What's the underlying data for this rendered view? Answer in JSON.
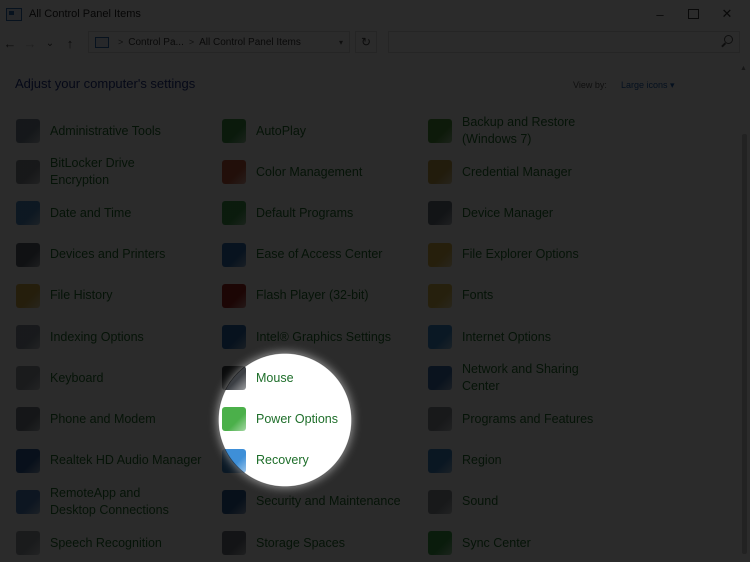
{
  "window": {
    "title": "All Control Panel Items",
    "minimize": "–",
    "close": "✕"
  },
  "nav": {
    "back": "←",
    "forward": "→",
    "recent": "⌄",
    "up": "↑",
    "refresh": "↻",
    "breadcrumb": [
      "Control Pa...",
      "All Control Panel Items"
    ],
    "breadcrumb_sep": ">",
    "search_placeholder": ""
  },
  "header": {
    "title": "Adjust your computer's settings",
    "view_by_label": "View by:",
    "view_by_value": "Large icons"
  },
  "items": [
    {
      "label": "Administrative Tools",
      "icon": "administrative-tools-icon",
      "color": "#7c8a99"
    },
    {
      "label": "AutoPlay",
      "icon": "autoplay-icon",
      "color": "#3f9b4a"
    },
    {
      "label": "Backup and Restore (Windows 7)",
      "icon": "backup-restore-icon",
      "color": "#4e9a3a"
    },
    {
      "label": "BitLocker Drive Encryption",
      "icon": "bitlocker-icon",
      "color": "#8a8f96"
    },
    {
      "label": "Color Management",
      "icon": "color-management-icon",
      "color": "#c85a3c"
    },
    {
      "label": "Credential Manager",
      "icon": "credential-manager-icon",
      "color": "#c9a54a"
    },
    {
      "label": "Date and Time",
      "icon": "date-time-icon",
      "color": "#4f8fc9"
    },
    {
      "label": "Default Programs",
      "icon": "default-programs-icon",
      "color": "#3fa24c"
    },
    {
      "label": "Device Manager",
      "icon": "device-manager-icon",
      "color": "#6d7785"
    },
    {
      "label": "Devices and Printers",
      "icon": "devices-printers-icon",
      "color": "#5c6470"
    },
    {
      "label": "Ease of Access Center",
      "icon": "ease-of-access-icon",
      "color": "#2f6fb5"
    },
    {
      "label": "File Explorer Options",
      "icon": "file-explorer-options-icon",
      "color": "#e0b84a"
    },
    {
      "label": "File History",
      "icon": "file-history-icon",
      "color": "#d9b24a"
    },
    {
      "label": "Flash Player (32-bit)",
      "icon": "flash-player-icon",
      "color": "#a8221c"
    },
    {
      "label": "Fonts",
      "icon": "fonts-icon",
      "color": "#e3c04e"
    },
    {
      "label": "Indexing Options",
      "icon": "indexing-options-icon",
      "color": "#8c96a3"
    },
    {
      "label": "Intel® Graphics Settings",
      "icon": "intel-graphics-icon",
      "color": "#2b6cb0"
    },
    {
      "label": "Internet Options",
      "icon": "internet-options-icon",
      "color": "#3b8fd4"
    },
    {
      "label": "Keyboard",
      "icon": "keyboard-icon",
      "color": "#9aa0a8"
    },
    {
      "label": "Mouse",
      "icon": "mouse-icon",
      "color": "#3c3f44"
    },
    {
      "label": "Network and Sharing Center",
      "icon": "network-sharing-icon",
      "color": "#3a6fb0"
    },
    {
      "label": "Phone and Modem",
      "icon": "phone-modem-icon",
      "color": "#7a828c"
    },
    {
      "label": "Power Options",
      "icon": "power-options-icon",
      "color": "#4bb04a"
    },
    {
      "label": "Programs and Features",
      "icon": "programs-features-icon",
      "color": "#8d939b"
    },
    {
      "label": "Realtek HD Audio Manager",
      "icon": "realtek-audio-icon",
      "color": "#2f5f9e"
    },
    {
      "label": "Recovery",
      "icon": "recovery-icon",
      "color": "#3e8fd8"
    },
    {
      "label": "Region",
      "icon": "region-icon",
      "color": "#3c86c9"
    },
    {
      "label": "RemoteApp and Desktop Connections",
      "icon": "remoteapp-icon",
      "color": "#4e82c2"
    },
    {
      "label": "Security and Maintenance",
      "icon": "security-maintenance-icon",
      "color": "#2a5d9a"
    },
    {
      "label": "Sound",
      "icon": "sound-icon",
      "color": "#8c9299"
    },
    {
      "label": "Speech Recognition",
      "icon": "speech-recognition-icon",
      "color": "#9ba1a8"
    },
    {
      "label": "Storage Spaces",
      "icon": "storage-spaces-icon",
      "color": "#6f7680"
    },
    {
      "label": "Sync Center",
      "icon": "sync-center-icon",
      "color": "#3ea64a"
    }
  ]
}
